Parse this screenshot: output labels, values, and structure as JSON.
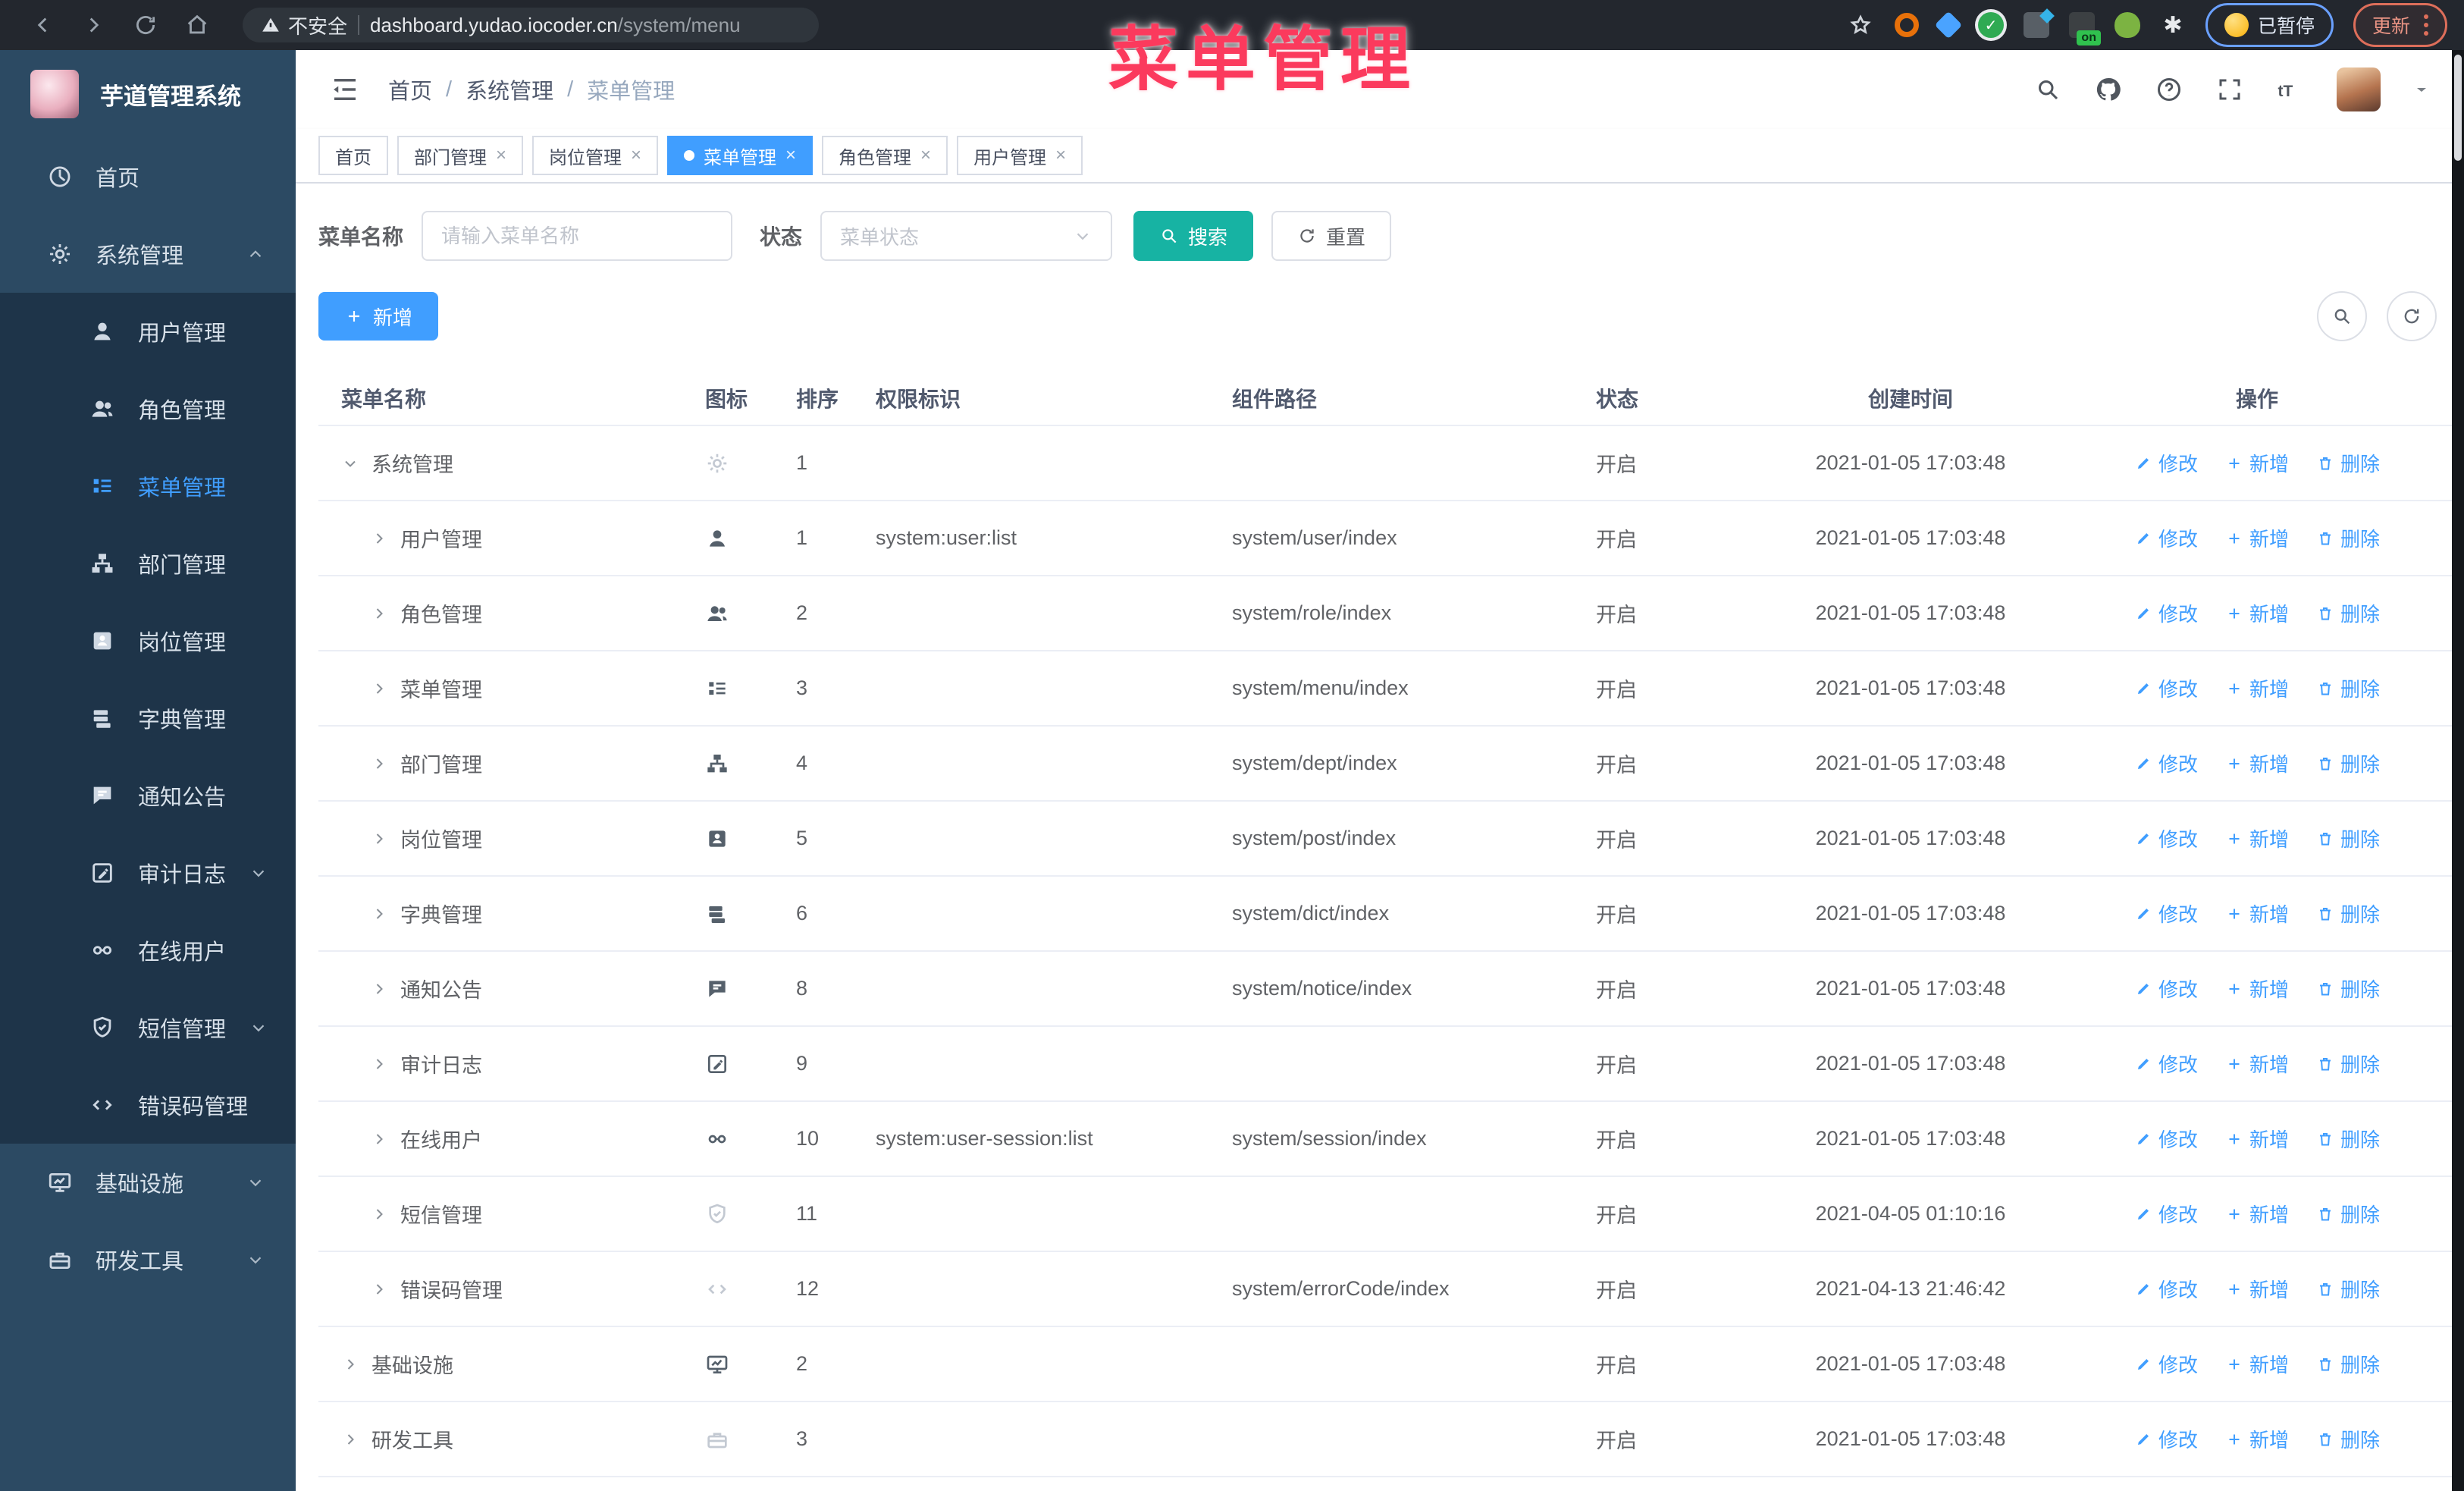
{
  "browser": {
    "security_label": "不安全",
    "url_host": "dashboard.yudao.iocoder.cn",
    "url_path": "/system/menu",
    "paused_badge": "已暂停",
    "update_button": "更新"
  },
  "watermark": "菜单管理",
  "colors": {
    "primary": "#409eff",
    "search_teal": "#17b3a3",
    "watermark_pink": "#fb3a5d",
    "sidebar_bg": "#2c4a63",
    "sidebar_sub_bg": "#1e3449"
  },
  "sidebar": {
    "logo_title": "芋道管理系统",
    "items": [
      {
        "key": "home",
        "label": "首页",
        "icon": "dashboard",
        "level": 0
      },
      {
        "key": "system",
        "label": "系统管理",
        "icon": "gear",
        "level": 0,
        "chevron": "up",
        "open": true
      },
      {
        "key": "user",
        "label": "用户管理",
        "icon": "user",
        "level": 1
      },
      {
        "key": "role",
        "label": "角色管理",
        "icon": "users",
        "level": 1
      },
      {
        "key": "menu",
        "label": "菜单管理",
        "icon": "menu",
        "level": 1,
        "active": true
      },
      {
        "key": "dept",
        "label": "部门管理",
        "icon": "tree",
        "level": 1
      },
      {
        "key": "post",
        "label": "岗位管理",
        "icon": "badge",
        "level": 1
      },
      {
        "key": "dict",
        "label": "字典管理",
        "icon": "book",
        "level": 1
      },
      {
        "key": "notice",
        "label": "通知公告",
        "icon": "chat",
        "level": 1
      },
      {
        "key": "audit-log",
        "label": "审计日志",
        "icon": "editlog",
        "level": 1,
        "chevron": "down"
      },
      {
        "key": "online-user",
        "label": "在线用户",
        "icon": "online",
        "level": 1
      },
      {
        "key": "sms",
        "label": "短信管理",
        "icon": "shield",
        "level": 1,
        "chevron": "down"
      },
      {
        "key": "error-code",
        "label": "错误码管理",
        "icon": "code",
        "level": 1
      },
      {
        "key": "infra",
        "label": "基础设施",
        "icon": "monitor",
        "level": 0,
        "chevron": "down"
      },
      {
        "key": "dev-tools",
        "label": "研发工具",
        "icon": "toolbox",
        "level": 0,
        "chevron": "down"
      }
    ]
  },
  "header": {
    "breadcrumb": [
      "首页",
      "系统管理",
      "菜单管理"
    ]
  },
  "tabs": [
    {
      "key": "home",
      "label": "首页"
    },
    {
      "key": "dept",
      "label": "部门管理",
      "closable": true
    },
    {
      "key": "post",
      "label": "岗位管理",
      "closable": true
    },
    {
      "key": "menu",
      "label": "菜单管理",
      "closable": true,
      "active": true
    },
    {
      "key": "role",
      "label": "角色管理",
      "closable": true
    },
    {
      "key": "user",
      "label": "用户管理",
      "closable": true
    }
  ],
  "filters": {
    "name_label": "菜单名称",
    "name_placeholder": "请输入菜单名称",
    "status_label": "状态",
    "status_placeholder": "菜单状态",
    "search_label": "搜索",
    "reset_label": "重置"
  },
  "toolbar": {
    "add_label": "新增"
  },
  "table": {
    "columns": [
      "菜单名称",
      "图标",
      "排序",
      "权限标识",
      "组件路径",
      "状态",
      "创建时间",
      "操作"
    ],
    "ops": {
      "edit": "修改",
      "add": "新增",
      "delete": "删除"
    },
    "rows": [
      {
        "name": "系统管理",
        "level": 0,
        "expanded": true,
        "icon": "gear",
        "light": true,
        "sort": "1",
        "perm": "",
        "path": "",
        "status": "开启",
        "time": "2021-01-05 17:03:48"
      },
      {
        "name": "用户管理",
        "level": 1,
        "expanded": false,
        "icon": "user",
        "light": false,
        "sort": "1",
        "perm": "system:user:list",
        "path": "system/user/index",
        "status": "开启",
        "time": "2021-01-05 17:03:48"
      },
      {
        "name": "角色管理",
        "level": 1,
        "expanded": false,
        "icon": "users",
        "light": false,
        "sort": "2",
        "perm": "",
        "path": "system/role/index",
        "status": "开启",
        "time": "2021-01-05 17:03:48"
      },
      {
        "name": "菜单管理",
        "level": 1,
        "expanded": false,
        "icon": "menu",
        "light": false,
        "sort": "3",
        "perm": "",
        "path": "system/menu/index",
        "status": "开启",
        "time": "2021-01-05 17:03:48"
      },
      {
        "name": "部门管理",
        "level": 1,
        "expanded": false,
        "icon": "tree",
        "light": false,
        "sort": "4",
        "perm": "",
        "path": "system/dept/index",
        "status": "开启",
        "time": "2021-01-05 17:03:48"
      },
      {
        "name": "岗位管理",
        "level": 1,
        "expanded": false,
        "icon": "badge",
        "light": false,
        "sort": "5",
        "perm": "",
        "path": "system/post/index",
        "status": "开启",
        "time": "2021-01-05 17:03:48"
      },
      {
        "name": "字典管理",
        "level": 1,
        "expanded": false,
        "icon": "book",
        "light": false,
        "sort": "6",
        "perm": "",
        "path": "system/dict/index",
        "status": "开启",
        "time": "2021-01-05 17:03:48"
      },
      {
        "name": "通知公告",
        "level": 1,
        "expanded": false,
        "icon": "chat",
        "light": false,
        "sort": "8",
        "perm": "",
        "path": "system/notice/index",
        "status": "开启",
        "time": "2021-01-05 17:03:48"
      },
      {
        "name": "审计日志",
        "level": 1,
        "expanded": false,
        "icon": "editlog",
        "light": false,
        "sort": "9",
        "perm": "",
        "path": "",
        "status": "开启",
        "time": "2021-01-05 17:03:48"
      },
      {
        "name": "在线用户",
        "level": 1,
        "expanded": false,
        "icon": "online",
        "light": false,
        "sort": "10",
        "perm": "system:user-session:list",
        "path": "system/session/index",
        "status": "开启",
        "time": "2021-01-05 17:03:48"
      },
      {
        "name": "短信管理",
        "level": 1,
        "expanded": false,
        "icon": "shield",
        "light": true,
        "sort": "11",
        "perm": "",
        "path": "",
        "status": "开启",
        "time": "2021-04-05 01:10:16"
      },
      {
        "name": "错误码管理",
        "level": 1,
        "expanded": false,
        "icon": "code",
        "light": true,
        "sort": "12",
        "perm": "",
        "path": "system/errorCode/index",
        "status": "开启",
        "time": "2021-04-13 21:46:42"
      },
      {
        "name": "基础设施",
        "level": 0,
        "expanded": false,
        "icon": "monitor",
        "light": false,
        "sort": "2",
        "perm": "",
        "path": "",
        "status": "开启",
        "time": "2021-01-05 17:03:48"
      },
      {
        "name": "研发工具",
        "level": 0,
        "expanded": false,
        "icon": "toolbox",
        "light": true,
        "sort": "3",
        "perm": "",
        "path": "",
        "status": "开启",
        "time": "2021-01-05 17:03:48"
      }
    ]
  }
}
